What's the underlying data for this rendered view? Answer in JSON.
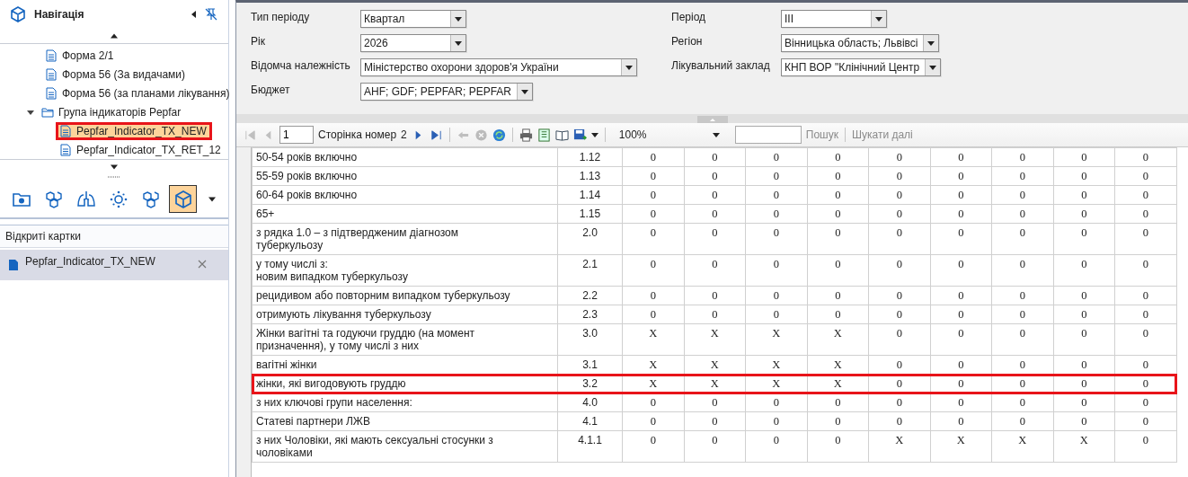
{
  "navigation": {
    "title": "Навігація",
    "tree": [
      {
        "label": "Форма 2/1",
        "kind": "file",
        "selected": false
      },
      {
        "label": "Форма 56 (За видачами)",
        "kind": "file",
        "selected": false
      },
      {
        "label": "Форма 56 (за планами лікування)",
        "kind": "file",
        "selected": false
      },
      {
        "label": "Група індикаторів Pepfar",
        "kind": "folder",
        "selected": false,
        "expanded": true,
        "children": [
          {
            "label": "Pepfar_Indicator_TX_NEW",
            "kind": "file",
            "selected": true
          },
          {
            "label": "Pepfar_Indicator_TX_RET_12",
            "kind": "file",
            "selected": false
          }
        ]
      }
    ],
    "modules": [
      {
        "selected": false
      },
      {
        "selected": false
      },
      {
        "selected": false
      },
      {
        "selected": false
      },
      {
        "selected": false
      },
      {
        "selected": true
      }
    ]
  },
  "open_cards": {
    "title": "Відкриті картки",
    "items": [
      {
        "label": "Pepfar_Indicator_TX_NEW",
        "selected": true
      }
    ]
  },
  "filters": {
    "left": [
      {
        "label": "Тип періоду",
        "value": "Квартал"
      },
      {
        "label": "Рік",
        "value": "2026"
      },
      {
        "label": "Відомча належність",
        "value": "Міністерство охорони здоров'я України"
      },
      {
        "label": "Бюджет",
        "value": "AHF; GDF; PEPFAR; PEPFAR"
      }
    ],
    "right": [
      {
        "label": "Період",
        "value": "III"
      },
      {
        "label": "Регіон",
        "value": "Вінницька область; Львівсі"
      },
      {
        "label": "Лікувальний заклад",
        "value": "КНП ВОР \"Клінічний Центр"
      }
    ]
  },
  "toolbar": {
    "page": "1",
    "page_label": "Сторінка номер",
    "page_count": "2",
    "zoom": "100%",
    "search_label": "Пошук",
    "find_next": "Шукати далі",
    "buttons": [
      {
        "disabled": true
      },
      {
        "disabled": true
      },
      {
        "disabled": false
      },
      {
        "disabled": false
      },
      {
        "disabled": true
      },
      {
        "disabled": true
      },
      {
        "disabled": false
      },
      {
        "disabled": false
      },
      {
        "disabled": false
      },
      {
        "disabled": false
      },
      {
        "disabled": false
      }
    ]
  },
  "table": {
    "rows": [
      {
        "name": "50-54 років включно",
        "code": "1.12",
        "values": [
          "0",
          "0",
          "0",
          "0",
          "0",
          "0",
          "0",
          "0",
          "0"
        ],
        "outlined": false
      },
      {
        "name": "55-59 років включно",
        "code": "1.13",
        "values": [
          "0",
          "0",
          "0",
          "0",
          "0",
          "0",
          "0",
          "0",
          "0"
        ],
        "outlined": false
      },
      {
        "name": "60-64 років включно",
        "code": "1.14",
        "values": [
          "0",
          "0",
          "0",
          "0",
          "0",
          "0",
          "0",
          "0",
          "0"
        ],
        "outlined": false
      },
      {
        "name": "65+",
        "code": "1.15",
        "values": [
          "0",
          "0",
          "0",
          "0",
          "0",
          "0",
          "0",
          "0",
          "0"
        ],
        "outlined": false
      },
      {
        "name": "з рядка 1.0 – з підтвердженим діагнозом туберкульозу",
        "code": "2.0",
        "values": [
          "0",
          "0",
          "0",
          "0",
          "0",
          "0",
          "0",
          "0",
          "0"
        ],
        "outlined": false
      },
      {
        "name": "у тому числі з:\nновим випадком туберкульозу",
        "code": "2.1",
        "values": [
          "0",
          "0",
          "0",
          "0",
          "0",
          "0",
          "0",
          "0",
          "0"
        ],
        "outlined": false
      },
      {
        "name": "рецидивом або повторним випадком туберкульозу",
        "code": "2.2",
        "values": [
          "0",
          "0",
          "0",
          "0",
          "0",
          "0",
          "0",
          "0",
          "0"
        ],
        "outlined": false
      },
      {
        "name": "отримують лікування туберкульозу",
        "code": "2.3",
        "values": [
          "0",
          "0",
          "0",
          "0",
          "0",
          "0",
          "0",
          "0",
          "0"
        ],
        "outlined": false
      },
      {
        "name": "Жінки вагітні та годуючи груддю (на момент призначення), у тому числі з них",
        "code": "3.0",
        "values": [
          "X",
          "X",
          "X",
          "X",
          "0",
          "0",
          "0",
          "0",
          "0"
        ],
        "outlined": false
      },
      {
        "name": "вагітні жінки",
        "code": "3.1",
        "values": [
          "X",
          "X",
          "X",
          "X",
          "0",
          "0",
          "0",
          "0",
          "0"
        ],
        "outlined": false
      },
      {
        "name": "жінки, які вигодовують груддю",
        "code": "3.2",
        "values": [
          "X",
          "X",
          "X",
          "X",
          "0",
          "0",
          "0",
          "0",
          "0"
        ],
        "outlined": true
      },
      {
        "name": "з них ключові групи населення:",
        "code": "4.0",
        "values": [
          "0",
          "0",
          "0",
          "0",
          "0",
          "0",
          "0",
          "0",
          "0"
        ],
        "outlined": false
      },
      {
        "name": "Статеві партнери ЛЖВ",
        "code": "4.1",
        "values": [
          "0",
          "0",
          "0",
          "0",
          "0",
          "0",
          "0",
          "0",
          "0"
        ],
        "outlined": false
      },
      {
        "name": "з них Чоловіки, які мають сексуальні стосунки з чоловіками",
        "code": "4.1.1",
        "values": [
          "0",
          "0",
          "0",
          "0",
          "X",
          "X",
          "X",
          "X",
          "0"
        ],
        "outlined": false
      }
    ]
  }
}
